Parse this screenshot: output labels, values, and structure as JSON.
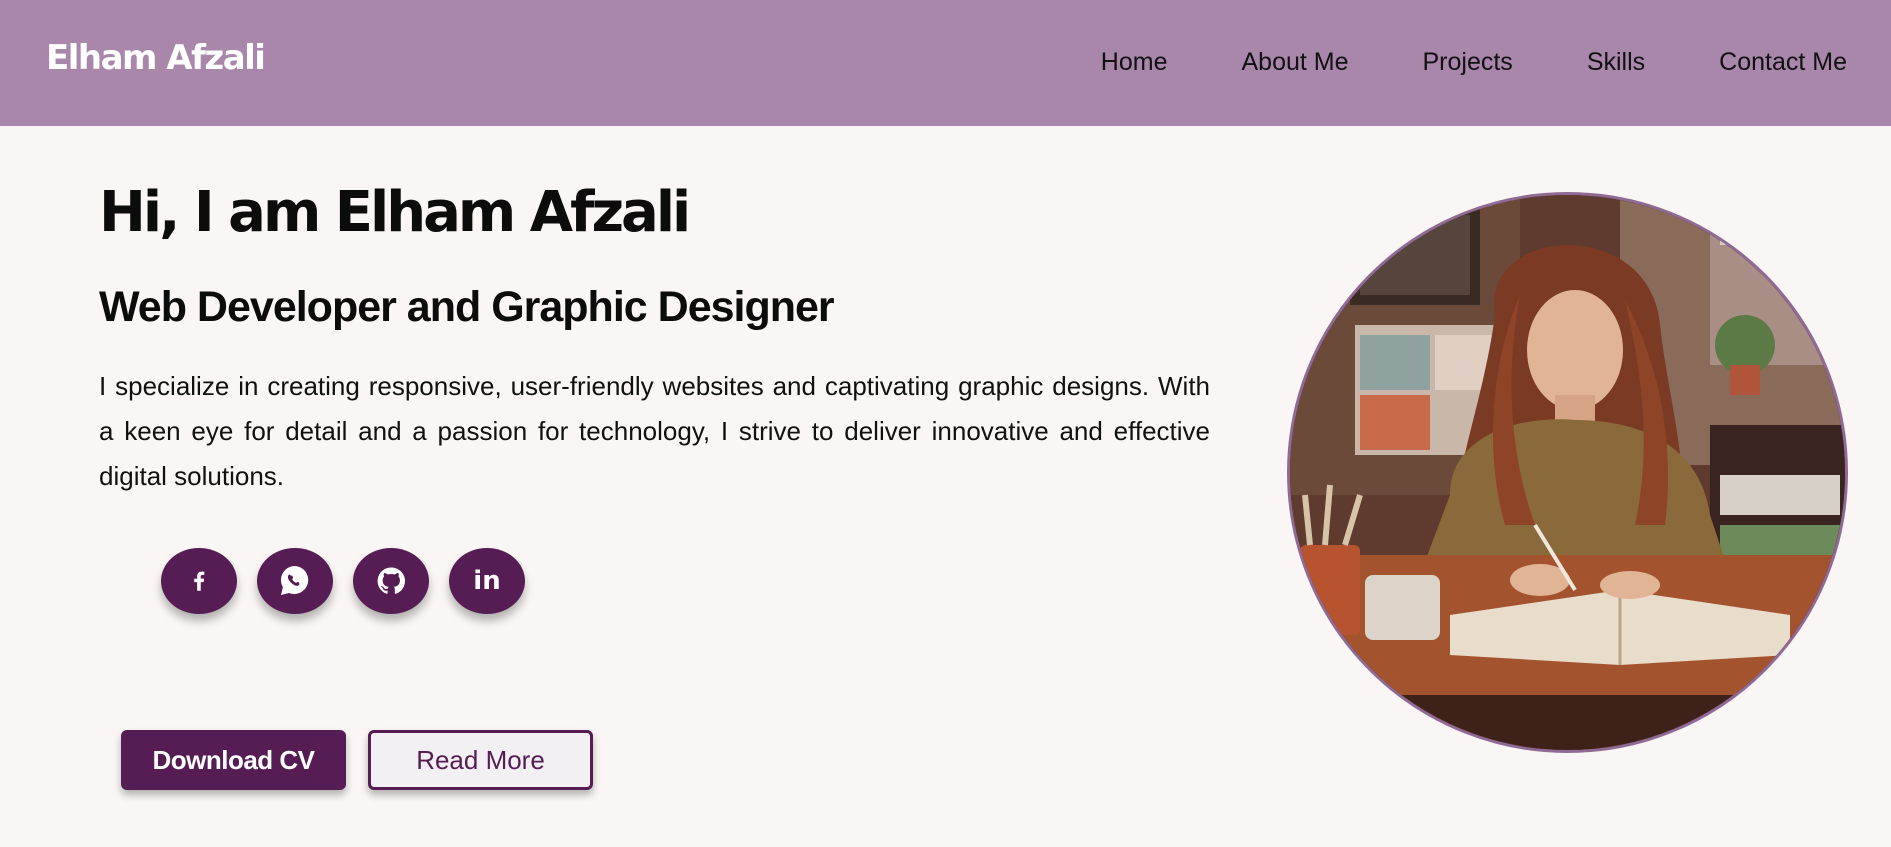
{
  "header": {
    "brand": "Elham Afzali",
    "nav": [
      {
        "label": "Home"
      },
      {
        "label": "About Me"
      },
      {
        "label": "Projects"
      },
      {
        "label": "Skills"
      },
      {
        "label": "Contact Me"
      }
    ]
  },
  "hero": {
    "title": "Hi, I am Elham Afzali",
    "subtitle": "Web Developer and Graphic Designer",
    "description": "I specialize in creating responsive, user-friendly websites and captivating graphic designs. With a keen eye for detail and a passion for technology, I strive to deliver innovative and effective digital solutions.",
    "socials": [
      {
        "icon": "facebook-icon"
      },
      {
        "icon": "whatsapp-icon"
      },
      {
        "icon": "github-icon"
      },
      {
        "icon": "linkedin-icon",
        "text": "in"
      }
    ],
    "buttons": {
      "download": "Download CV",
      "read_more": "Read More"
    }
  },
  "colors": {
    "header_bg": "#a887aa",
    "page_bg": "#f9f6f5",
    "accent": "#561c54",
    "portrait_border": "#8f6a94"
  }
}
